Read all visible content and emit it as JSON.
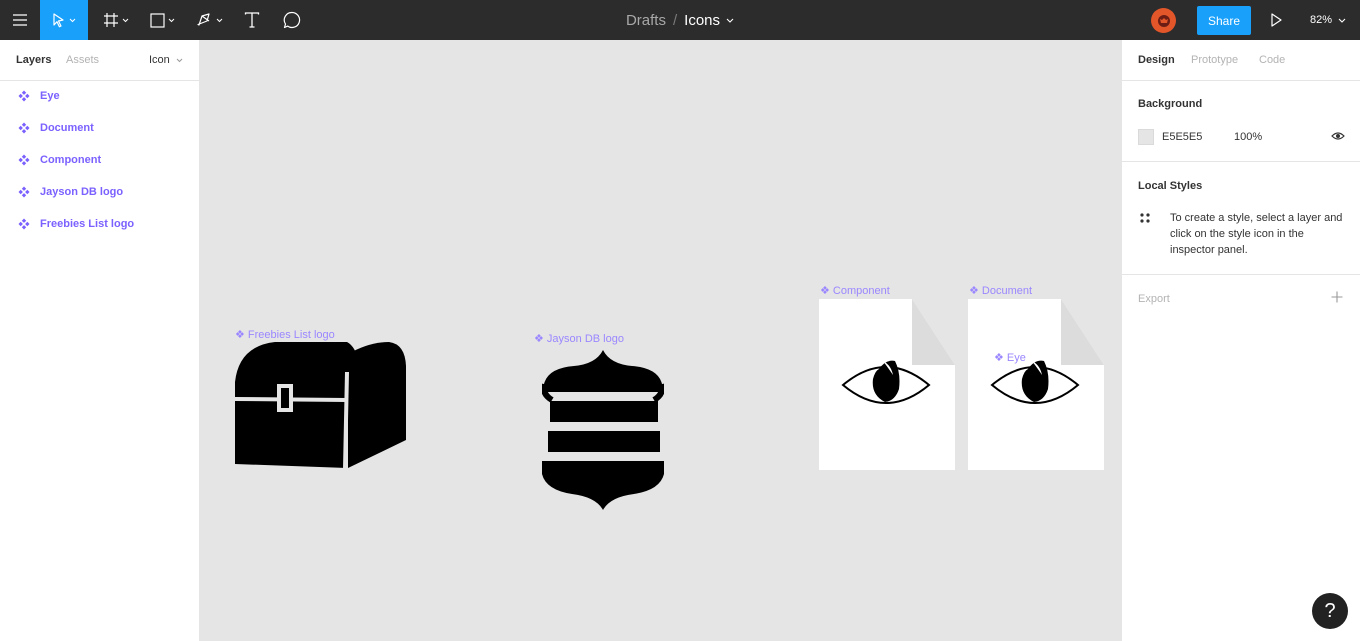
{
  "toolbar": {
    "tools": [
      "menu-icon",
      "move-tool",
      "frame-tool",
      "shape-tool",
      "pen-tool",
      "text-tool",
      "comment-tool"
    ],
    "breadcrumb_parent": "Drafts",
    "breadcrumb_sep": "/",
    "file_name": "Icons",
    "share_label": "Share",
    "zoom_label": "82%",
    "accent_color": "#18a0fb"
  },
  "left_panel": {
    "tab_layers": "Layers",
    "tab_assets": "Assets",
    "page_selector": "Icon",
    "layers": [
      {
        "label": "Eye"
      },
      {
        "label": "Document"
      },
      {
        "label": "Component"
      },
      {
        "label": "Jayson DB logo"
      },
      {
        "label": "Freebies List logo"
      }
    ],
    "component_color": "#7b61ff"
  },
  "canvas": {
    "background": "#E5E5E5",
    "frames": {
      "freebies": "❖ Freebies List logo",
      "jayson": "❖ Jayson DB logo",
      "component": "❖ Component",
      "document": "❖ Document",
      "eye": "❖ Eye"
    }
  },
  "right_panel": {
    "tab_design": "Design",
    "tab_prototype": "Prototype",
    "tab_code": "Code",
    "background_title": "Background",
    "background_hex": "E5E5E5",
    "background_opacity": "100%",
    "local_styles_title": "Local Styles",
    "local_styles_hint": "To create a style, select a layer and click on the style icon in the inspector panel.",
    "export_title": "Export"
  },
  "help_label": "?"
}
